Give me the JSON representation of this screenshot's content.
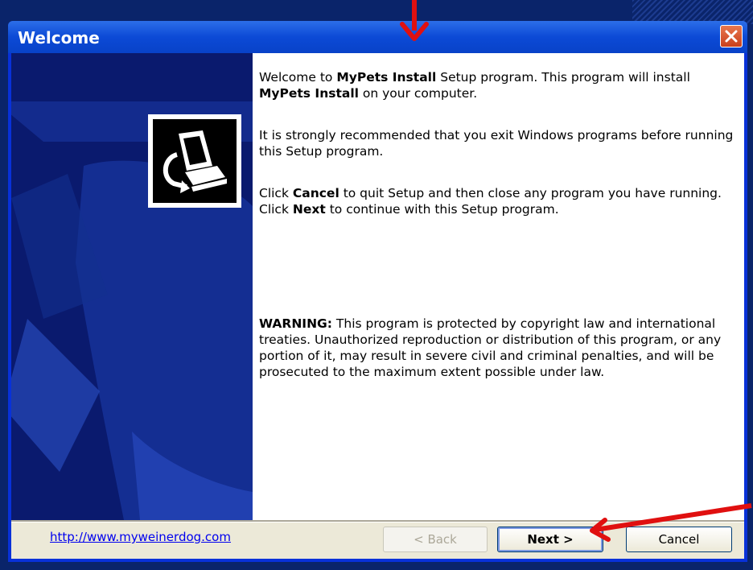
{
  "window": {
    "title": "Welcome"
  },
  "content": {
    "p1": {
      "a": "Welcome to ",
      "b1": "MyPets Install",
      "c": " Setup program. This program will install ",
      "b2": "MyPets Install",
      "d": " on your computer."
    },
    "p2": "It is strongly recommended that you exit Windows programs before running this Setup program.",
    "p3": {
      "a": "Click ",
      "b1": "Cancel",
      "c": " to quit Setup and then close any program you have running. Click ",
      "b2": "Next",
      "d": " to continue with this Setup program."
    },
    "p4": {
      "b": "WARNING:",
      "rest": " This program is protected by copyright law and international treaties. Unauthorized reproduction or distribution of this program, or any portion of it, may result in severe civil and criminal penalties, and will be prosecuted to the maximum extent possible under law."
    }
  },
  "footer": {
    "link": "http://www.myweinerdog.com",
    "back_label": "< Back",
    "next_label": "Next >",
    "cancel_label": "Cancel"
  },
  "colors": {
    "title_bar": "#0c4ad6",
    "side_panel": "#0a1a6e",
    "annotation_arrow": "#e01010"
  }
}
